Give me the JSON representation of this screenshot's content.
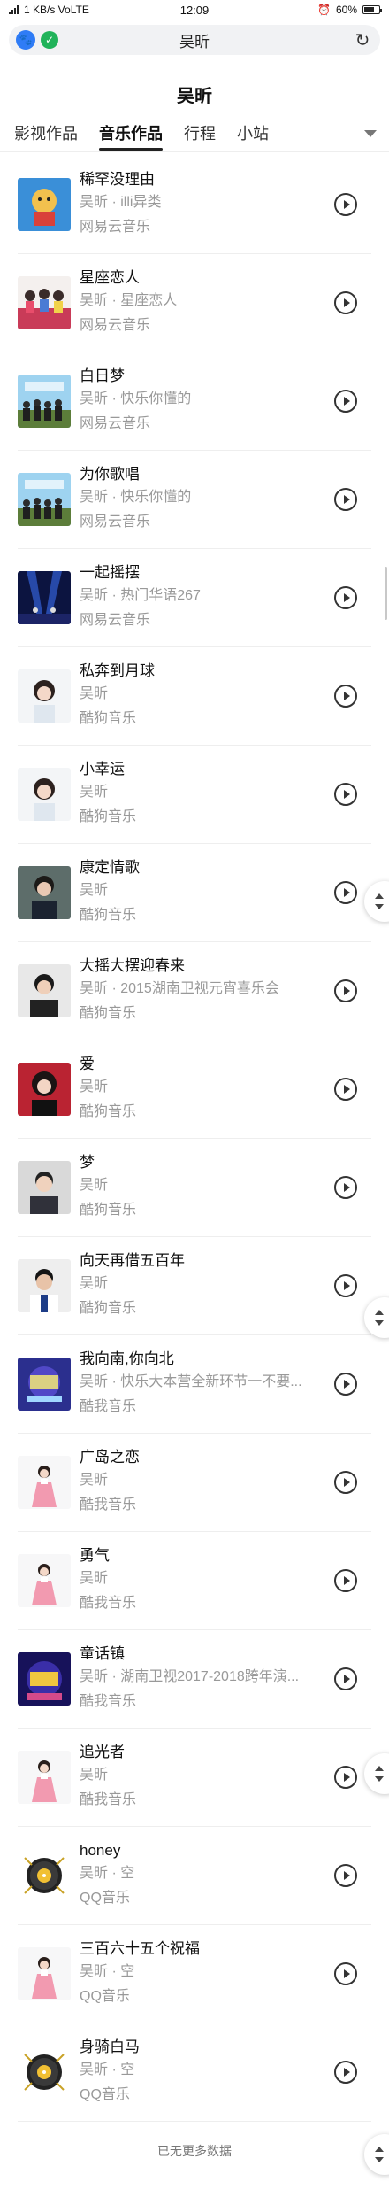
{
  "status_bar": {
    "left": "1 KB/s VoLTE",
    "time": "12:09",
    "battery": "60%"
  },
  "url_bar": {
    "text": "吴昕"
  },
  "page": {
    "title": "吴昕"
  },
  "tabs": [
    {
      "label": "影视作品"
    },
    {
      "label": "音乐作品"
    },
    {
      "label": "行程"
    },
    {
      "label": "小站"
    }
  ],
  "songs": [
    {
      "title": "稀罕没理由",
      "subtitle": "吴昕 · illi异类",
      "source": "网易云音乐",
      "cover": "cartoon"
    },
    {
      "title": "星座恋人",
      "subtitle": "吴昕 · 星座恋人",
      "source": "网易云音乐",
      "cover": "group-pink"
    },
    {
      "title": "白日梦",
      "subtitle": "吴昕 · 快乐你懂的",
      "source": "网易云音乐",
      "cover": "group-sky"
    },
    {
      "title": "为你歌唱",
      "subtitle": "吴昕 · 快乐你懂的",
      "source": "网易云音乐",
      "cover": "group-sky"
    },
    {
      "title": "一起摇摆",
      "subtitle": "吴昕 · 热门华语267",
      "source": "网易云音乐",
      "cover": "stage"
    },
    {
      "title": "私奔到月球",
      "subtitle": "吴昕",
      "source": "酷狗音乐",
      "cover": "portrait-light"
    },
    {
      "title": "小幸运",
      "subtitle": "吴昕",
      "source": "酷狗音乐",
      "cover": "portrait-light"
    },
    {
      "title": "康定情歌",
      "subtitle": "吴昕",
      "source": "酷狗音乐",
      "cover": "portrait-dark"
    },
    {
      "title": "大摇大摆迎春来",
      "subtitle": "吴昕 · 2015湖南卫视元宵喜乐会",
      "source": "酷狗音乐",
      "cover": "portrait-man"
    },
    {
      "title": "爱",
      "subtitle": "吴昕",
      "source": "酷狗音乐",
      "cover": "portrait-woman"
    },
    {
      "title": "梦",
      "subtitle": "吴昕",
      "source": "酷狗音乐",
      "cover": "portrait-man2"
    },
    {
      "title": "向天再借五百年",
      "subtitle": "吴昕",
      "source": "酷狗音乐",
      "cover": "portrait-man3"
    },
    {
      "title": "我向南,你向北",
      "subtitle": "吴昕 · 快乐大本营全新环节一不要...",
      "source": "酷我音乐",
      "cover": "poster-blue"
    },
    {
      "title": "广岛之恋",
      "subtitle": "吴昕",
      "source": "酷我音乐",
      "cover": "girl-pink"
    },
    {
      "title": "勇气",
      "subtitle": "吴昕",
      "source": "酷我音乐",
      "cover": "girl-pink"
    },
    {
      "title": "童话镇",
      "subtitle": "吴昕 · 湖南卫视2017-2018跨年演...",
      "source": "酷我音乐",
      "cover": "poster-night"
    },
    {
      "title": "追光者",
      "subtitle": "吴昕",
      "source": "酷我音乐",
      "cover": "girl-pink"
    },
    {
      "title": "honey",
      "subtitle": "吴昕 · 空",
      "source": "QQ音乐",
      "cover": "disc"
    },
    {
      "title": "三百六十五个祝福",
      "subtitle": "吴昕 · 空",
      "source": "QQ音乐",
      "cover": "girl-pink"
    },
    {
      "title": "身骑白马",
      "subtitle": "吴昕 · 空",
      "source": "QQ音乐",
      "cover": "disc"
    }
  ],
  "footer": {
    "text": "已无更多数据"
  },
  "icons": {
    "paw": "paw-icon",
    "shield": "shield-check-icon",
    "refresh": "refresh-icon",
    "play": "play-circle-icon",
    "dropdown": "triangle-down-icon",
    "scroll": "scroll-up-down-icon"
  }
}
